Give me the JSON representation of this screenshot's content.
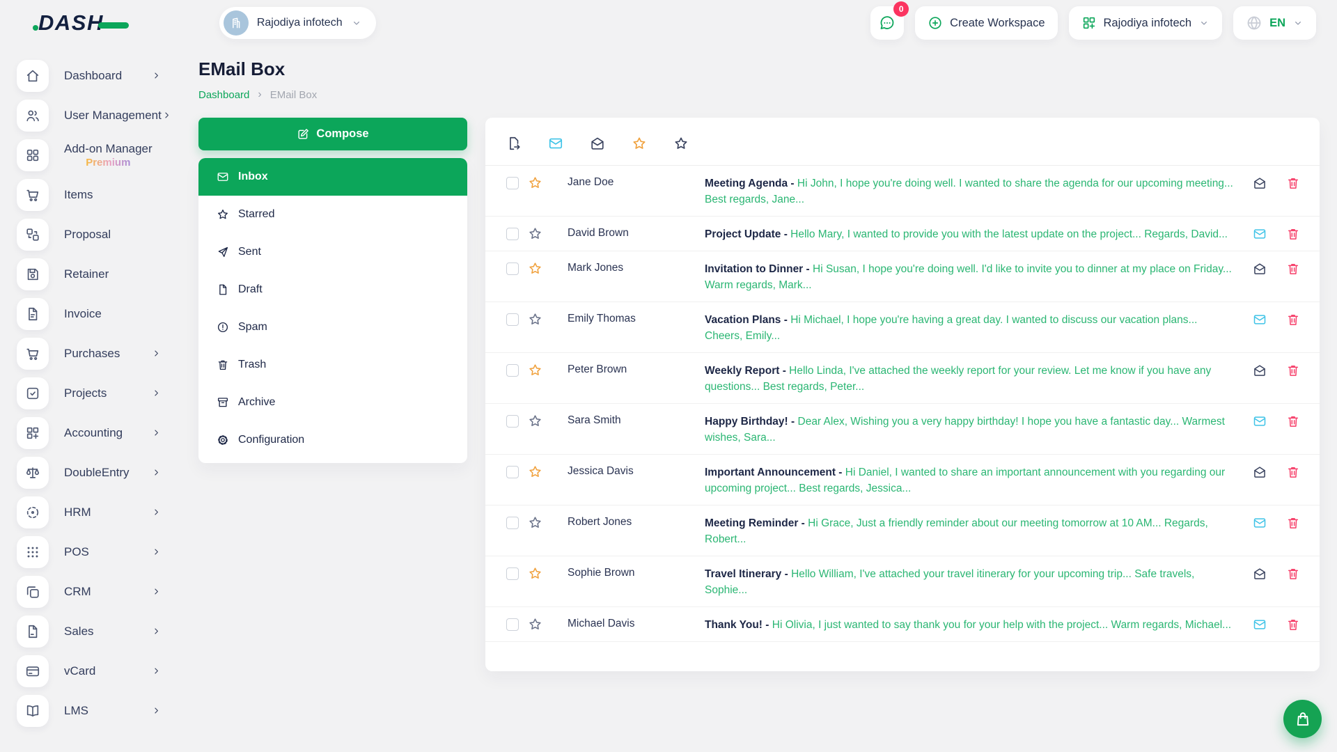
{
  "brand": {
    "name": "DASH"
  },
  "topbar": {
    "workspace_switcher": {
      "label": "Rajodiya infotech",
      "avatar_icon": "building-icon"
    },
    "messages_button": {
      "icon": "chat-icon",
      "badge": "0"
    },
    "create_workspace": {
      "label": "Create Workspace",
      "icon": "plus-circle-icon"
    },
    "company_menu": {
      "label": "Rajodiya infotech",
      "icon": "grid-plus-icon"
    },
    "language_menu": {
      "label": "EN",
      "icon": "globe-icon"
    }
  },
  "sidebar": {
    "items": [
      {
        "label": "Dashboard",
        "icon": "home",
        "expandable": true
      },
      {
        "label": "User Management",
        "icon": "users",
        "expandable": true
      },
      {
        "label": "Add-on Manager",
        "icon": "grid",
        "expandable": false,
        "badge": "Premium"
      },
      {
        "label": "Items",
        "icon": "cart",
        "expandable": false
      },
      {
        "label": "Proposal",
        "icon": "swap",
        "expandable": false
      },
      {
        "label": "Retainer",
        "icon": "save",
        "expandable": false
      },
      {
        "label": "Invoice",
        "icon": "file-text",
        "expandable": false
      },
      {
        "label": "Purchases",
        "icon": "cart",
        "expandable": true
      },
      {
        "label": "Projects",
        "icon": "check-square",
        "expandable": true
      },
      {
        "label": "Accounting",
        "icon": "grid-plus",
        "expandable": true
      },
      {
        "label": "DoubleEntry",
        "icon": "scales",
        "expandable": true
      },
      {
        "label": "HRM",
        "icon": "crosshair",
        "expandable": true
      },
      {
        "label": "POS",
        "icon": "dots",
        "expandable": true
      },
      {
        "label": "CRM",
        "icon": "copy",
        "expandable": true
      },
      {
        "label": "Sales",
        "icon": "file",
        "expandable": true
      },
      {
        "label": "vCard",
        "icon": "card",
        "expandable": true
      },
      {
        "label": "LMS",
        "icon": "book",
        "expandable": true
      }
    ]
  },
  "page": {
    "title": "EMail Box",
    "breadcrumb_home": "Dashboard",
    "breadcrumb_sep": "›",
    "breadcrumb_current": "EMail Box"
  },
  "mailbox": {
    "compose": {
      "label": "Compose",
      "icon": "edit"
    },
    "folders": [
      {
        "label": "Inbox",
        "icon": "mail",
        "active": true
      },
      {
        "label": "Starred",
        "icon": "star",
        "active": false
      },
      {
        "label": "Sent",
        "icon": "send",
        "active": false
      },
      {
        "label": "Draft",
        "icon": "file-blank",
        "active": false
      },
      {
        "label": "Spam",
        "icon": "alert",
        "active": false
      },
      {
        "label": "Trash",
        "icon": "trash",
        "active": false
      },
      {
        "label": "Archive",
        "icon": "archive",
        "active": false
      },
      {
        "label": "Configuration",
        "icon": "gear",
        "active": false
      }
    ],
    "toolbar": [
      {
        "name": "export",
        "icon": "file-export",
        "tone": "dark"
      },
      {
        "name": "mark-unread",
        "icon": "mail",
        "tone": "cyan"
      },
      {
        "name": "mark-read",
        "icon": "mail-open",
        "tone": "dark"
      },
      {
        "name": "starred-filter",
        "icon": "star",
        "tone": "orange"
      },
      {
        "name": "unstarred-filter",
        "icon": "star",
        "tone": "dark"
      }
    ],
    "emails": [
      {
        "sender": "Jane Doe",
        "subject": "Meeting Agenda -",
        "preview": "Hi John, I hope you're doing well. I wanted to share the agenda for our upcoming meeting... Best regards, Jane...",
        "starred": true,
        "unread": false
      },
      {
        "sender": "David Brown",
        "subject": "Project Update -",
        "preview": "Hello Mary, I wanted to provide you with the latest update on the project... Regards, David...",
        "starred": false,
        "unread": true
      },
      {
        "sender": "Mark Jones",
        "subject": "Invitation to Dinner -",
        "preview": "Hi Susan, I hope you're doing well. I'd like to invite you to dinner at my place on Friday... Warm regards, Mark...",
        "starred": true,
        "unread": false
      },
      {
        "sender": "Emily Thomas",
        "subject": "Vacation Plans -",
        "preview": "Hi Michael, I hope you're having a great day. I wanted to discuss our vacation plans... Cheers, Emily...",
        "starred": false,
        "unread": true
      },
      {
        "sender": "Peter Brown",
        "subject": "Weekly Report -",
        "preview": "Hello Linda, I've attached the weekly report for your review. Let me know if you have any questions... Best regards, Peter...",
        "starred": true,
        "unread": false
      },
      {
        "sender": "Sara Smith",
        "subject": "Happy Birthday! -",
        "preview": "Dear Alex, Wishing you a very happy birthday! I hope you have a fantastic day... Warmest wishes, Sara...",
        "starred": false,
        "unread": true
      },
      {
        "sender": "Jessica Davis",
        "subject": "Important Announcement -",
        "preview": "Hi Daniel, I wanted to share an important announcement with you regarding our upcoming project... Best regards, Jessica...",
        "starred": true,
        "unread": false
      },
      {
        "sender": "Robert Jones",
        "subject": "Meeting Reminder -",
        "preview": "Hi Grace, Just a friendly reminder about our meeting tomorrow at 10 AM... Regards, Robert...",
        "starred": false,
        "unread": true
      },
      {
        "sender": "Sophie Brown",
        "subject": "Travel Itinerary -",
        "preview": "Hello William, I've attached your travel itinerary for your upcoming trip... Safe travels, Sophie...",
        "starred": true,
        "unread": false
      },
      {
        "sender": "Michael Davis",
        "subject": "Thank You! -",
        "preview": "Hi Olivia, I just wanted to say thank you for your help with the project... Warm regards, Michael...",
        "starred": false,
        "unread": true
      }
    ]
  },
  "fab": {
    "icon": "shopping-bag"
  },
  "colors": {
    "primary_green": "#0ca65a",
    "preview_green": "#2bb673",
    "unread_cyan": "#3ec3e7",
    "star_orange": "#f0a13d",
    "danger_pink": "#f63d68",
    "badge_pink": "#fb3460",
    "dark_text": "#1d2746"
  }
}
